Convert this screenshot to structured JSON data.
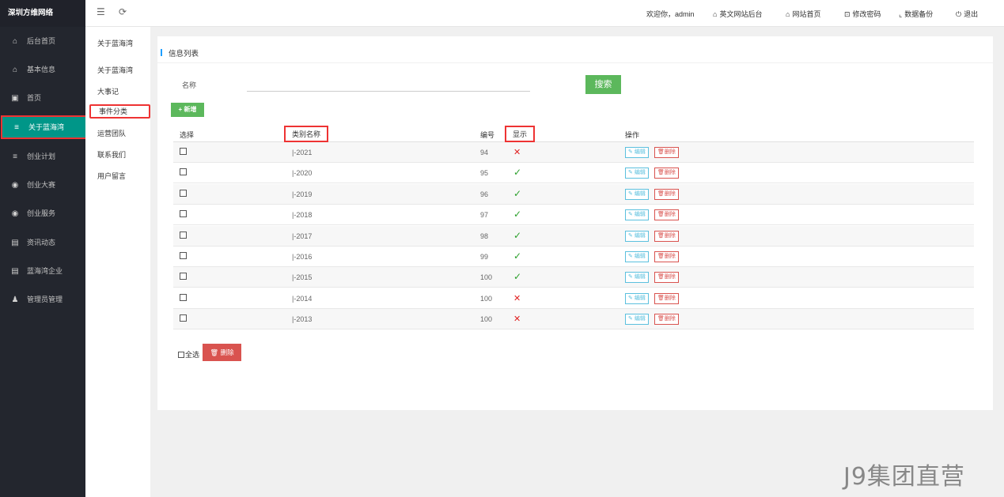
{
  "brand": "深圳方维网络",
  "sidebar": {
    "items": [
      {
        "label": "后台首页",
        "icon": "home-icon"
      },
      {
        "label": "基本信息",
        "icon": "home-icon"
      },
      {
        "label": "首页",
        "icon": "image-icon"
      },
      {
        "label": "关于蓝海湾",
        "icon": "list-icon",
        "active": true
      },
      {
        "label": "创业计划",
        "icon": "list-icon"
      },
      {
        "label": "创业大赛",
        "icon": "globe-icon"
      },
      {
        "label": "创业服务",
        "icon": "globe-icon"
      },
      {
        "label": "资讯动态",
        "icon": "newspaper-icon"
      },
      {
        "label": "蓝海湾企业",
        "icon": "newspaper-icon"
      },
      {
        "label": "管理员管理",
        "icon": "users-icon"
      }
    ]
  },
  "subnav": {
    "title": "关于蓝海湾",
    "items": [
      "关于蓝海湾",
      "大事记",
      "事件分类",
      "运营团队",
      "联系我们",
      "用户留言"
    ],
    "active_index": 2
  },
  "header": {
    "welcome": "欢迎你，admin",
    "links": [
      "英文网站后台",
      "网站首页",
      "修改密码",
      "数据备份",
      "退出"
    ]
  },
  "panel": {
    "title": "信息列表",
    "search_label": "名称",
    "search_value": "",
    "search_button": "搜索",
    "add_button": "+ 新增"
  },
  "table": {
    "headers": [
      "选择",
      "类别名称",
      "编号",
      "显示",
      "操作"
    ],
    "rows": [
      {
        "name": "|-2021",
        "num": "94",
        "show": false
      },
      {
        "name": "|-2020",
        "num": "95",
        "show": true
      },
      {
        "name": "|-2019",
        "num": "96",
        "show": true
      },
      {
        "name": "|-2018",
        "num": "97",
        "show": true
      },
      {
        "name": "|-2017",
        "num": "98",
        "show": true
      },
      {
        "name": "|-2016",
        "num": "99",
        "show": true
      },
      {
        "name": "|-2015",
        "num": "100",
        "show": true
      },
      {
        "name": "|-2014",
        "num": "100",
        "show": false
      },
      {
        "name": "|-2013",
        "num": "100",
        "show": false
      }
    ],
    "edit_label": "编辑",
    "delete_label": "删除",
    "yes_mark": "✓",
    "no_mark": "✕"
  },
  "footer": {
    "select_all": "全选",
    "delete_button": "删除"
  },
  "watermark": "J9集团直营",
  "colors": {
    "sidebar_bg": "#23262e",
    "active": "#009688",
    "primary_green": "#5cb85c",
    "danger": "#d9534f",
    "info": "#5bc0de",
    "highlight": "#e33333"
  }
}
